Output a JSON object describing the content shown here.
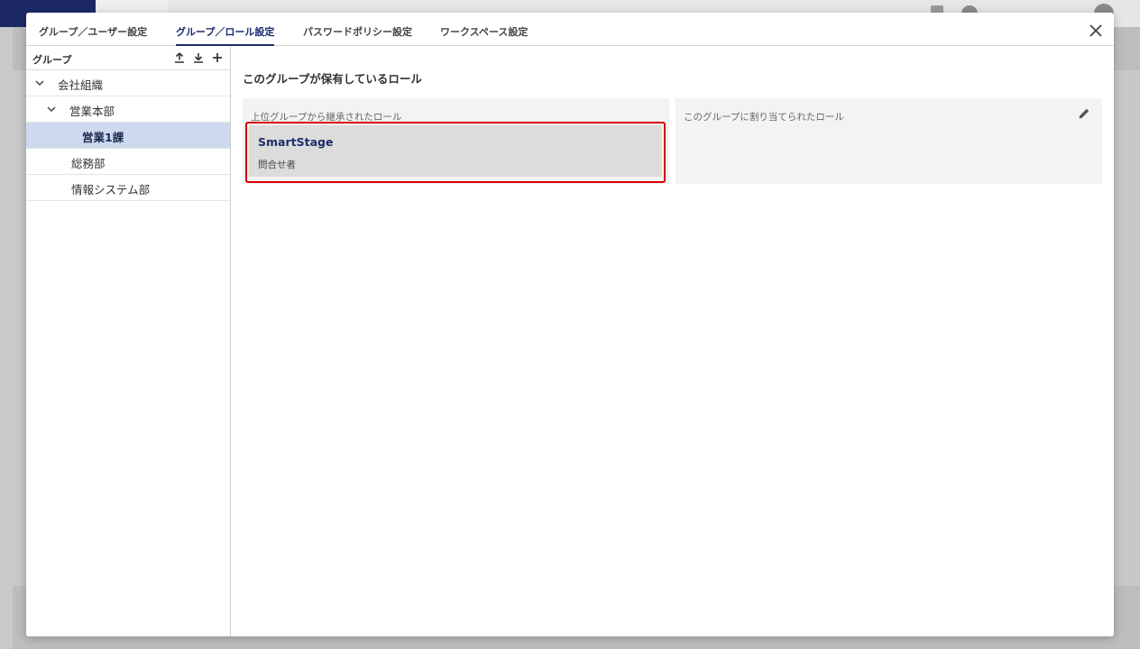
{
  "tabs": [
    {
      "label": "グループ／ユーザー設定",
      "active": false
    },
    {
      "label": "グループ／ロール設定",
      "active": true
    },
    {
      "label": "パスワードポリシー設定",
      "active": false
    },
    {
      "label": "ワークスペース設定",
      "active": false
    }
  ],
  "sidebar": {
    "title": "グループ",
    "tree": [
      {
        "label": "会社組織",
        "expanded": true
      },
      {
        "label": "営業本部",
        "expanded": true
      },
      {
        "label": "営業1課",
        "selected": true
      },
      {
        "label": "総務部"
      },
      {
        "label": "情報システム部"
      }
    ]
  },
  "main": {
    "section_title": "このグループが保有しているロール",
    "inherited": {
      "label": "上位グループから継承されたロール",
      "roles": [
        {
          "name": "SmartStage",
          "description": "問合せ者"
        }
      ]
    },
    "assigned": {
      "label": "このグループに割り当てられたロール"
    }
  },
  "colors": {
    "accent": "#1c2a6e",
    "selected_bg": "#cdd9ef",
    "highlight": "#d60000"
  },
  "icons": {
    "close": "close-icon",
    "upload": "upload-icon",
    "download": "download-icon",
    "add": "plus-icon",
    "edit": "pencil-icon"
  }
}
